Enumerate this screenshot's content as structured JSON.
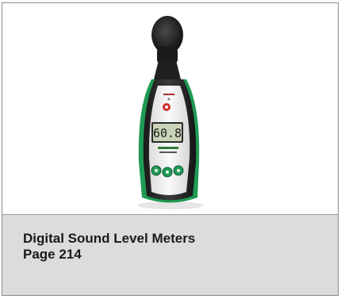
{
  "product": {
    "title": "Digital Sound Level Meters",
    "page": "Page 214",
    "display_reading": "60.8",
    "image_icon": "sound-level-meter-image"
  },
  "colors": {
    "caption_bg": "#dcdcdc",
    "border": "#8a8a8a",
    "meter_green": "#1f9a54",
    "meter_body": "#2a2a2a",
    "meter_face": "#f4f4f4",
    "lcd_bg": "#c9d3b8"
  }
}
